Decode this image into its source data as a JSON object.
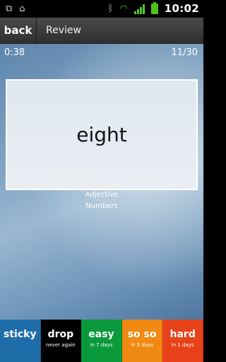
{
  "statusbar": {
    "time": "10:02",
    "icons_left": [
      "usb-icon",
      "camera-icon"
    ],
    "icons_right": [
      "bluetooth-icon",
      "wifi-icon",
      "signal-icon",
      "battery-icon"
    ]
  },
  "header": {
    "back_label": "back",
    "title": "Review"
  },
  "session": {
    "timer": "0:38",
    "progress": "11/30"
  },
  "card": {
    "word": "eight",
    "part_of_speech": "Adjective",
    "category": "Numbers"
  },
  "buttons": [
    {
      "label": "sticky",
      "sub": "",
      "color": "#1f6da8"
    },
    {
      "label": "drop",
      "sub": "never again",
      "color": "#000000"
    },
    {
      "label": "easy",
      "sub": "in 7 days",
      "color": "#0a9a3c"
    },
    {
      "label": "so so",
      "sub": "in 5 days",
      "color": "#f08a12"
    },
    {
      "label": "hard",
      "sub": "in 1 days",
      "color": "#e8421a"
    }
  ]
}
